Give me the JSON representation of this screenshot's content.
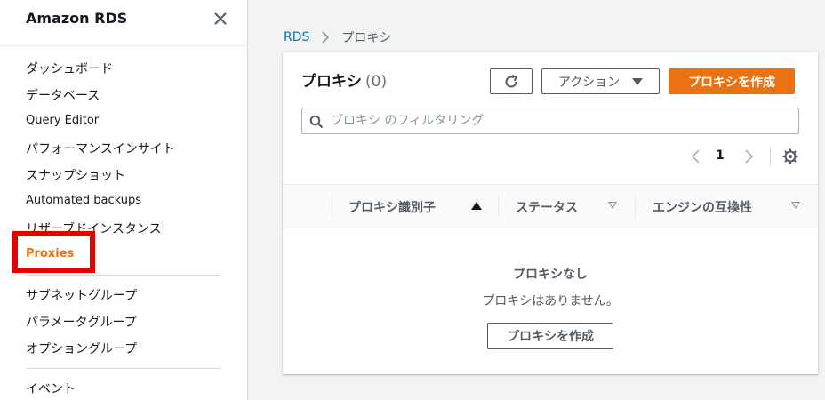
{
  "sidebar": {
    "title": "Amazon RDS",
    "items": [
      {
        "label": "ダッシュボード"
      },
      {
        "label": "データベース"
      },
      {
        "label": "Query Editor"
      },
      {
        "label": "パフォーマンスインサイト"
      },
      {
        "label": "スナップショット"
      },
      {
        "label": "Automated backups"
      },
      {
        "label": "リザーブドインスタンス"
      },
      {
        "label": "Proxies"
      },
      {
        "label": "サブネットグループ"
      },
      {
        "label": "パラメータグループ"
      },
      {
        "label": "オプショングループ"
      },
      {
        "label": "イベント"
      }
    ]
  },
  "breadcrumb": {
    "root": "RDS",
    "current": "プロキシ"
  },
  "panel": {
    "title": "プロキシ",
    "count": "(0)",
    "actions_label": "アクション",
    "create_label": "プロキシを作成",
    "filter_placeholder": "プロキシ のフィルタリング",
    "page": "1",
    "columns": [
      {
        "label": "プロキシ識別子",
        "sort": "ascending"
      },
      {
        "label": "ステータス",
        "sort": "none"
      },
      {
        "label": "エンジンの互換性",
        "sort": "none"
      }
    ],
    "empty_title": "プロキシなし",
    "empty_desc": "プロキシはありません。",
    "empty_button": "プロキシを作成"
  },
  "colors": {
    "accent": "#ec7211",
    "link": "#0073bb",
    "highlight": "#e60000"
  }
}
